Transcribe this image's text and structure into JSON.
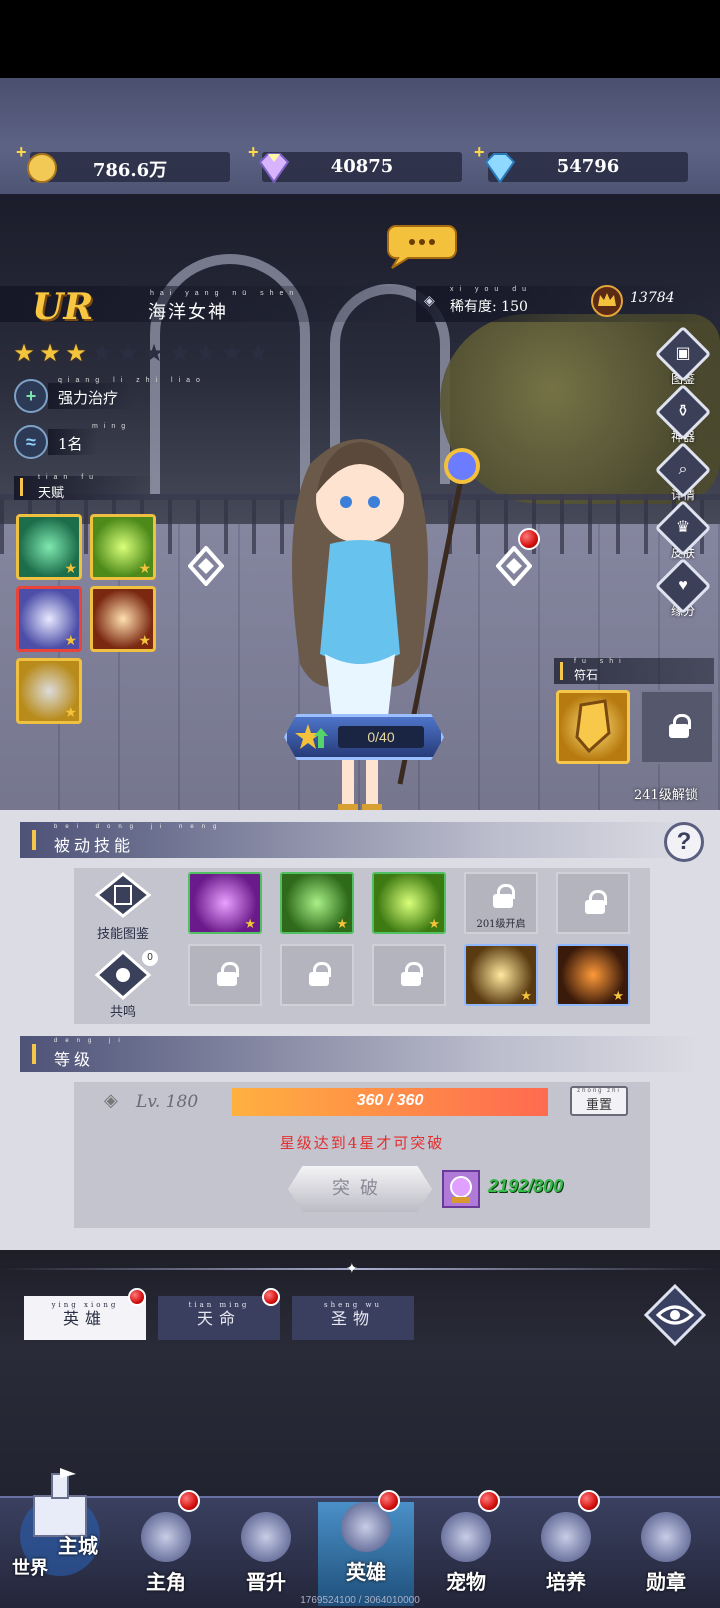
{
  "resources": [
    {
      "name": "gold",
      "value": "786.6万"
    },
    {
      "name": "rainbow-diamond",
      "value": "40875"
    },
    {
      "name": "blue-diamond",
      "value": "54796"
    }
  ],
  "hero": {
    "rarity": "UR",
    "name": "海洋女神",
    "name_pinyin": "hai yang nü shen",
    "stars_total": 10,
    "stars_filled": 3,
    "rarity_value_label": "稀有度: 150",
    "rarity_value_pinyin": "xi you du",
    "power": "13784",
    "trait": "强力治疗",
    "trait_pinyin": "qiang li zhi liao",
    "rank": "1名",
    "rank_pinyin": "ming",
    "talent_label": "天赋",
    "talent_pinyin": "tian fu"
  },
  "side_menu": [
    {
      "label": "图鉴",
      "icon": "codex-icon"
    },
    {
      "label": "神器",
      "icon": "artifact-icon"
    },
    {
      "label": "详情",
      "icon": "magnifier-icon"
    },
    {
      "label": "皮肤",
      "icon": "skin-icon"
    },
    {
      "label": "缘分",
      "icon": "heart-icon"
    }
  ],
  "upgrade": {
    "progress": "0/40"
  },
  "rune": {
    "label": "符石",
    "pinyin": "fu shi",
    "unlock_text": "241级解锁"
  },
  "passive": {
    "title": "被动技能",
    "pinyin": "bei dong ji neng",
    "codex_label": "技能图鉴",
    "resonance_label": "共鸣",
    "resonance_count": "0",
    "slot_unlock_text": "201级开启"
  },
  "level": {
    "title": "等级",
    "pinyin": "deng ji",
    "lv_label": "Lv. 180",
    "exp_text": "360 / 360",
    "exp_ratio": 1.0,
    "reset_label": "重置",
    "reset_pinyin": "zhong zhi",
    "notice": "星级达到4星才可突破",
    "breakthrough_label": "突破",
    "material_count": "2192/800"
  },
  "tabs": [
    {
      "label": "英雄",
      "pinyin": "ying xiong",
      "active": true,
      "dot": true
    },
    {
      "label": "天命",
      "pinyin": "tian ming",
      "active": false,
      "dot": true
    },
    {
      "label": "圣物",
      "pinyin": "sheng wu",
      "active": false,
      "dot": false
    }
  ],
  "nav": {
    "world_labels": [
      "主城",
      "世界"
    ],
    "items": [
      {
        "label": "主角",
        "dot": true
      },
      {
        "label": "晋升",
        "dot": false
      },
      {
        "label": "英雄",
        "dot": true,
        "active": true
      },
      {
        "label": "宠物",
        "dot": true
      },
      {
        "label": "培养",
        "dot": true
      },
      {
        "label": "勋章",
        "dot": false
      }
    ],
    "footer_text": "1769524100 / 3064010000"
  }
}
